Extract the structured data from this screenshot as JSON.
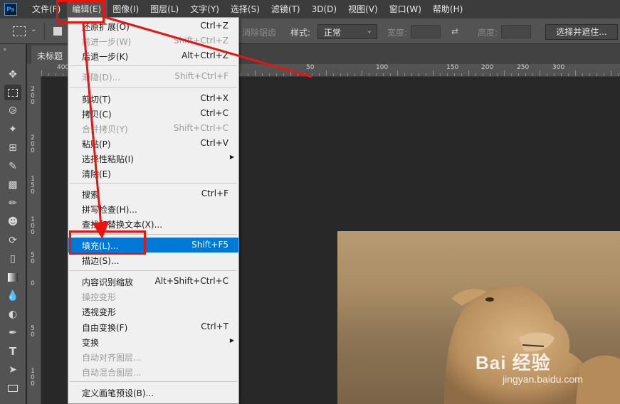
{
  "app": {
    "logo_text": "Ps"
  },
  "menubar": {
    "items": [
      "文件(F)",
      "编辑(E)",
      "图像(I)",
      "图层(L)",
      "文字(Y)",
      "选择(S)",
      "滤镜(T)",
      "3D(D)",
      "视图(V)",
      "窗口(W)",
      "帮助(H)"
    ]
  },
  "options": {
    "antialias_label": "消除锯齿",
    "style_label": "样式:",
    "style_value": "正常",
    "width_label": "宽度:",
    "height_label": "高度:",
    "select_mask_label": "选择并遮住..."
  },
  "document": {
    "tab_title": "未标题"
  },
  "ruler": {
    "top_labels": [
      "400",
      "50",
      "100",
      "150",
      "200",
      "250",
      "300"
    ],
    "left_labels": [
      "2 0 0",
      "2 0 0",
      "1 5 0",
      "1 0 0",
      "5 0",
      "0",
      "5 0",
      "1 0 0"
    ]
  },
  "edit_menu": {
    "items": [
      {
        "label": "还原扩展(O)",
        "shortcut": "Ctrl+Z",
        "state": "normal"
      },
      {
        "label": "前进一步(W)",
        "shortcut": "Shift+Ctrl+Z",
        "state": "disabled"
      },
      {
        "label": "后退一步(K)",
        "shortcut": "Alt+Ctrl+Z",
        "state": "normal"
      },
      {
        "label": "渐隐(D)...",
        "shortcut": "Shift+Ctrl+F",
        "state": "disabled"
      },
      {
        "label": "剪切(T)",
        "shortcut": "Ctrl+X",
        "state": "normal"
      },
      {
        "label": "拷贝(C)",
        "shortcut": "Ctrl+C",
        "state": "normal"
      },
      {
        "label": "合并拷贝(Y)",
        "shortcut": "Shift+Ctrl+C",
        "state": "disabled"
      },
      {
        "label": "粘贴(P)",
        "shortcut": "Ctrl+V",
        "state": "normal"
      },
      {
        "label": "选择性粘贴(I)",
        "shortcut": "",
        "state": "submenu"
      },
      {
        "label": "清除(E)",
        "shortcut": "",
        "state": "normal"
      },
      {
        "label": "搜索",
        "shortcut": "Ctrl+F",
        "state": "normal"
      },
      {
        "label": "拼写检查(H)...",
        "shortcut": "",
        "state": "normal"
      },
      {
        "label": "查找和替换文本(X)...",
        "shortcut": "",
        "state": "normal"
      },
      {
        "label": "填充(L)...",
        "shortcut": "Shift+F5",
        "state": "highlight"
      },
      {
        "label": "描边(S)...",
        "shortcut": "",
        "state": "normal"
      },
      {
        "label": "内容识别缩放",
        "shortcut": "Alt+Shift+Ctrl+C",
        "state": "normal"
      },
      {
        "label": "操控变形",
        "shortcut": "",
        "state": "disabled"
      },
      {
        "label": "透视变形",
        "shortcut": "",
        "state": "normal"
      },
      {
        "label": "自由变换(F)",
        "shortcut": "Ctrl+T",
        "state": "normal"
      },
      {
        "label": "变换",
        "shortcut": "",
        "state": "submenu"
      },
      {
        "label": "自动对齐图层...",
        "shortcut": "",
        "state": "disabled"
      },
      {
        "label": "自动混合图层...",
        "shortcut": "",
        "state": "disabled"
      },
      {
        "label": "定义画笔预设(B)...",
        "shortcut": "",
        "state": "normal"
      }
    ]
  },
  "tools": [
    "move-tool-icon",
    "marquee-tool-icon",
    "lasso-tool-icon",
    "magic-wand-tool-icon",
    "crop-tool-icon",
    "eyedropper-tool-icon",
    "healing-brush-tool-icon",
    "brush-tool-icon",
    "clone-stamp-tool-icon",
    "history-brush-tool-icon",
    "eraser-tool-icon",
    "gradient-tool-icon",
    "blur-tool-icon",
    "dodge-tool-icon",
    "pen-tool-icon",
    "type-tool-icon",
    "path-selection-tool-icon",
    "rectangle-tool-icon"
  ],
  "watermark": {
    "main": "Bai  经验",
    "sub": "jingyan.baidu.com"
  },
  "colors": {
    "highlight": "#0078d7",
    "annotation": "#e8150f"
  }
}
